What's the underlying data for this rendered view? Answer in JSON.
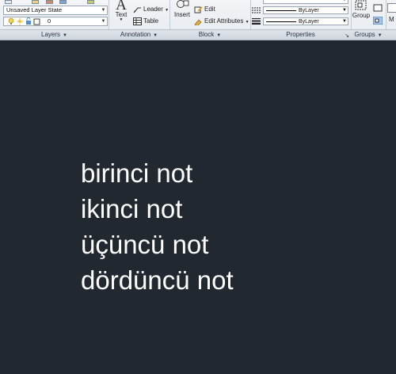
{
  "ribbon": {
    "layers": {
      "panel_label": "Layers",
      "layer_state_value": "Unsaved Layer State",
      "current_layer_value": "0"
    },
    "annotation": {
      "panel_label": "Annotation",
      "text_label": "Text",
      "leader_label": "Leader",
      "table_label": "Table"
    },
    "block": {
      "panel_label": "Block",
      "insert_label": "Insert",
      "edit_label": "Edit",
      "edit_attributes_label": "Edit Attributes"
    },
    "properties": {
      "panel_label": "Properties",
      "linetype_value": "ByLayer",
      "lineweight_value": "ByLayer"
    },
    "groups": {
      "panel_label": "Groups",
      "group_label": "Group"
    },
    "utilities": {
      "label": "M"
    }
  },
  "drawing": {
    "notes": [
      "birinci not",
      "ikinci not",
      "üçüncü not",
      "dördüncü not"
    ]
  },
  "colors": {
    "canvas_background": "#212830",
    "note_text": "#ffffff"
  }
}
